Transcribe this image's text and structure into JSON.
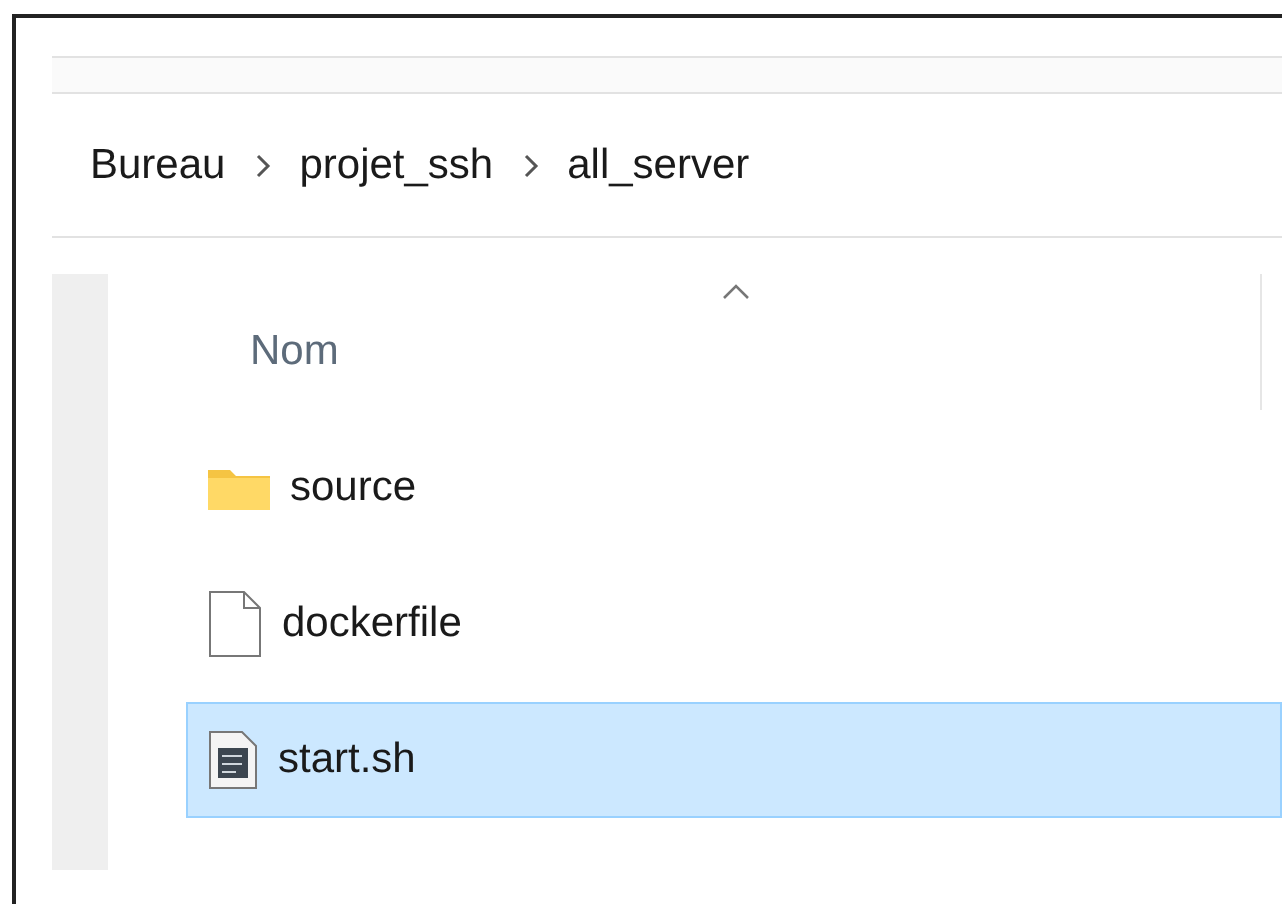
{
  "breadcrumb": [
    "Bureau",
    "projet_ssh",
    "all_server"
  ],
  "column_header": {
    "label": "Nom",
    "sort_ascending": true
  },
  "files": [
    {
      "name": "source",
      "kind": "folder",
      "selected": false
    },
    {
      "name": "dockerfile",
      "kind": "file",
      "selected": false
    },
    {
      "name": "start.sh",
      "kind": "script",
      "selected": true
    }
  ]
}
